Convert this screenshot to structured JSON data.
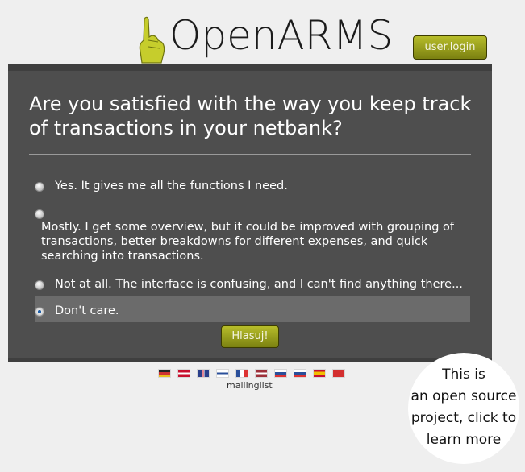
{
  "header": {
    "logo_text": "OpenARMS",
    "login_label": "user.login"
  },
  "poll": {
    "question": "Are you satisfied with the way you keep track of transactions in your netbank?",
    "options": [
      {
        "label": "Yes. It gives me all the functions I need.",
        "selected": false
      },
      {
        "label": "Mostly. I get some overview, but it could be improved with grouping of transactions, better breakdowns for different expenses, and quick searching into transactions.",
        "selected": false
      },
      {
        "label": "Not at all. The interface is confusing, and I can't find anything there...",
        "selected": false
      },
      {
        "label": "Don't care.",
        "selected": true
      }
    ],
    "vote_label": "Hlasuj!"
  },
  "footer": {
    "flags": [
      "german-flag-icon",
      "danish-flag-icon",
      "uk-flag-icon",
      "finnish-flag-icon",
      "french-flag-icon",
      "latvian-flag-icon",
      "russian-flag-icon",
      "slovak-flag-icon",
      "spanish-flag-icon",
      "turkish-flag-icon"
    ],
    "mailinglist_label": "mailinglist"
  },
  "open_source_bubble": {
    "line1": "This is",
    "line2": "an open source",
    "line3": "project, click to",
    "line4": "learn more"
  },
  "colors": {
    "accent": "#9ea11f",
    "panel": "#4e4e4e",
    "background": "#efefef"
  }
}
